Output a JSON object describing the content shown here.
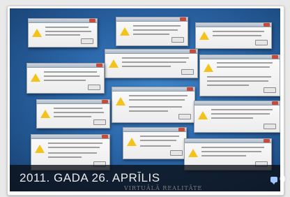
{
  "post": {
    "date": "2011. GADA 26. APRĪLIS",
    "magazine": "VIRTUĀLĀ REALITĀTE",
    "comment_count": "0",
    "comment_icon": "speech-bubble-icon"
  },
  "image": {
    "subject": "error-dialog-collage",
    "dialog_icon": "warning-triangle-icon"
  },
  "colors": {
    "caption_bg": "#0a0e14",
    "date_text": "#e8e8e8",
    "comment_icon": "#9fc7ff",
    "warning": "#f3c21b"
  }
}
